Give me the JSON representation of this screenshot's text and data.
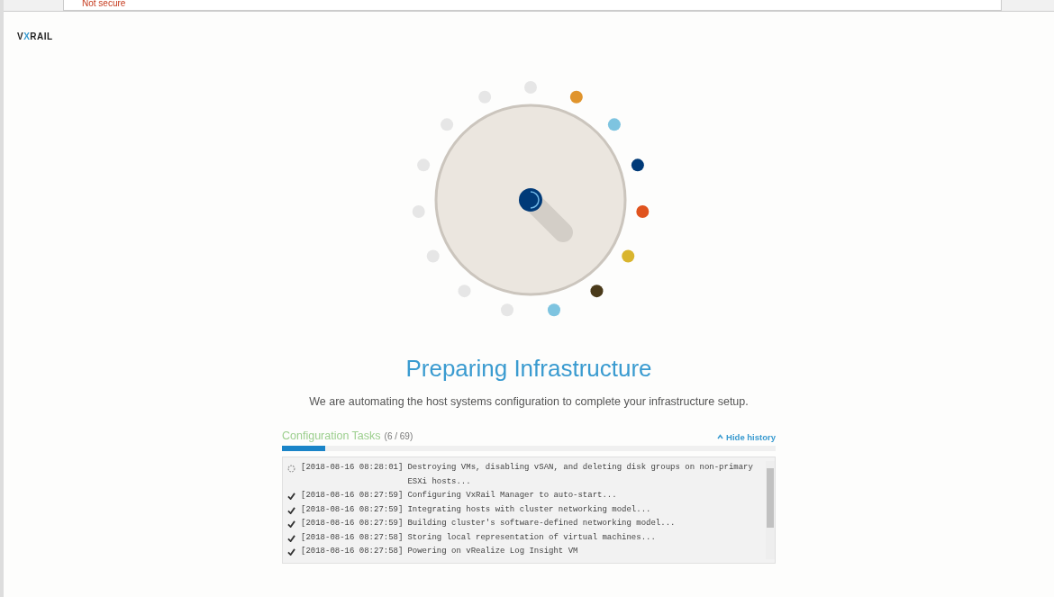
{
  "browser": {
    "security_label": "Not secure"
  },
  "logo": {
    "prefix": "V",
    "mark": "X",
    "suffix": "RAIL"
  },
  "progress_dial": {
    "dots": [
      {
        "color": "#e6e6e6"
      },
      {
        "color": "#e0942c"
      },
      {
        "color": "#7ec4e0"
      },
      {
        "color": "#003a78"
      },
      {
        "color": "#e0531e"
      },
      {
        "color": "#d9b52e"
      },
      {
        "color": "#4a3a1a"
      },
      {
        "color": "#7ec4e0"
      },
      {
        "color": "#e6e6e6"
      },
      {
        "color": "#e6e6e6"
      },
      {
        "color": "#e6e6e6"
      },
      {
        "color": "#e6e6e6"
      },
      {
        "color": "#e6e6e6"
      },
      {
        "color": "#e6e6e6"
      },
      {
        "color": "#e6e6e6"
      }
    ]
  },
  "title": "Preparing Infrastructure",
  "subtitle": "We are automating the host systems configuration to complete your infrastructure setup.",
  "tasks": {
    "heading": "Configuration Tasks",
    "count": "(6 / 69)",
    "toggle": "Hide history",
    "level": 0.087,
    "log": [
      {
        "done": false,
        "time": "[2018-08-16 08:28:01]",
        "message": "Destroying VMs, disabling vSAN, and deleting disk groups on non-primary ESXi hosts..."
      },
      {
        "done": true,
        "time": "[2018-08-16 08:27:59]",
        "message": "Configuring VxRail Manager to auto-start..."
      },
      {
        "done": true,
        "time": "[2018-08-16 08:27:59]",
        "message": "Integrating hosts with cluster networking model..."
      },
      {
        "done": true,
        "time": "[2018-08-16 08:27:59]",
        "message": "Building cluster's software-defined networking model..."
      },
      {
        "done": true,
        "time": "[2018-08-16 08:27:58]",
        "message": "Storing local representation of virtual machines..."
      },
      {
        "done": true,
        "time": "[2018-08-16 08:27:58]",
        "message": "Powering on vRealize Log Insight VM"
      }
    ]
  }
}
